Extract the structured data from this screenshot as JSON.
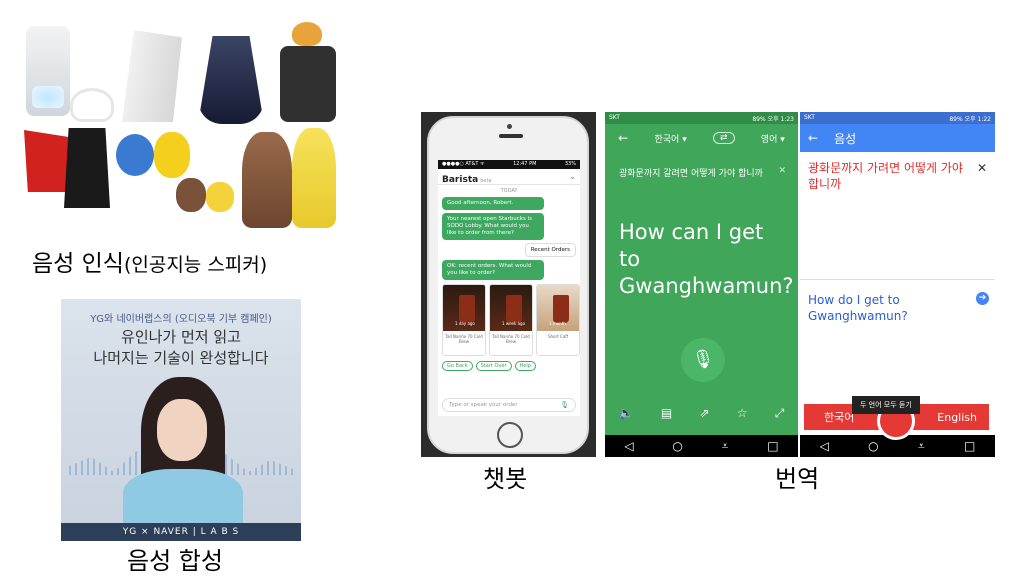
{
  "captions": {
    "speech_recognition": "음성 인식",
    "speech_recognition_sub": "(인공지능 스피커)",
    "chatbot": "챗봇",
    "translation": "번역",
    "speech_synthesis": "음성 합성"
  },
  "poster": {
    "tag": "YG와 네이버랩스의 (오디오북 기부 캠페인)",
    "line1": "유인나가 먼저 읽고",
    "line2": "나머지는 기술이 완성합니다",
    "footer": "YG × NAVER | L A B S"
  },
  "chatbot": {
    "status_left": "●●●●○ AT&T ᯤ",
    "status_time": "12:47 PM",
    "status_right": "33%",
    "title": "Barista",
    "beta": "beta",
    "day": "TODAY",
    "bot_greeting": "Good afternoon, Robert.",
    "bot_store": "Your nearest open Starbucks is SODO Lobby. What would you like to order from there?",
    "user_reply": "Recent Orders",
    "bot_recent": "OK: recent orders. What would you like to order?",
    "cards": [
      {
        "tag": "1 day ago",
        "caption": "Tall Nariño 70 Cold Brew"
      },
      {
        "tag": "1 week ago",
        "caption": "Tall Nariño 70 Cold Brew"
      },
      {
        "tag": "1 month",
        "caption": "Short Caff"
      }
    ],
    "quick_replies": [
      "Go Back",
      "Start Over",
      "Help"
    ],
    "input_placeholder": "Type or speak your order"
  },
  "translate_green": {
    "status_left": "SKT",
    "status_right": "89% 오후 1:23",
    "lang_from": "한국어 ▾",
    "lang_to": "영어 ▾",
    "source_text": "광화문까지 갈려면 어떻게 가야 합니까",
    "result_text": "How can I get to Gwanghwamun?"
  },
  "translate_white": {
    "status_left": "SKT",
    "status_right": "89% 오후 1:22",
    "header_title": "음성",
    "source_text": "광화문까지 가려면 어떻게 가야 합니까",
    "output_text": "How do I get to Gwanghwamun?",
    "tooltip": "두 언어 모두 듣기",
    "lang_left": "한국어",
    "lang_right": "English"
  },
  "colors": {
    "chat_green": "#3ea860",
    "translate_green": "#3fa65a",
    "translate_blue": "#4285f4",
    "source_red": "#e02d2d",
    "bar_red": "#e53935"
  }
}
